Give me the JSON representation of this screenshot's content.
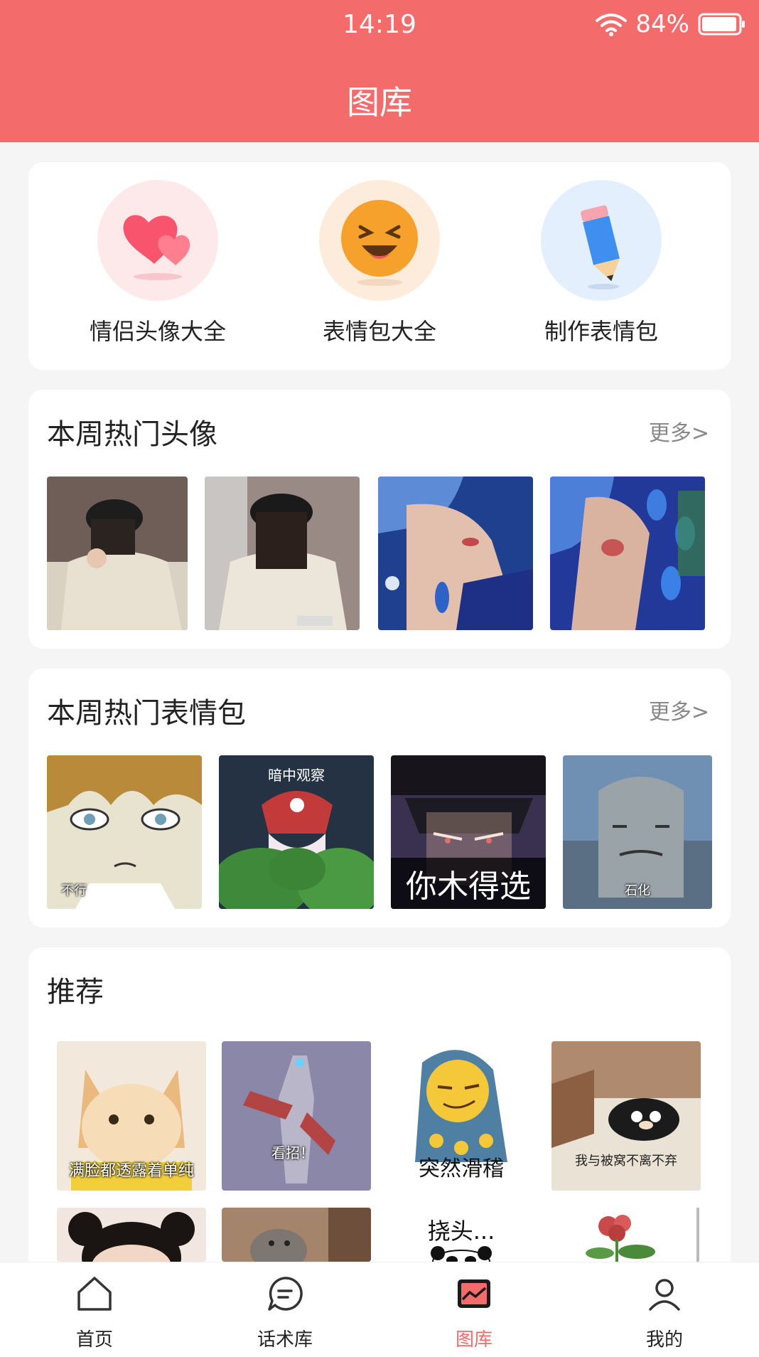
{
  "status_bar": {
    "time": "14:19",
    "battery": "84%"
  },
  "header": {
    "title": "图库"
  },
  "categories": [
    {
      "label": "情侣头像大全",
      "icon": "hearts-icon"
    },
    {
      "label": "表情包大全",
      "icon": "laughing-emoji-icon"
    },
    {
      "label": "制作表情包",
      "icon": "pencil-icon"
    }
  ],
  "hot_avatars": {
    "title": "本周热门头像",
    "more": "更多>"
  },
  "hot_stickers": {
    "title": "本周热门表情包",
    "more": "更多>",
    "captions": [
      "不行",
      "暗中观察",
      "你木得选",
      "石化"
    ]
  },
  "recommend": {
    "title": "推荐",
    "captions": [
      "满脸都透露着单纯",
      "看招！",
      "突然滑稽",
      "我与被窝不离不弃",
      "挠头..."
    ]
  },
  "tabbar": [
    {
      "label": "首页",
      "icon": "home-icon"
    },
    {
      "label": "话术库",
      "icon": "chat-bubble-icon"
    },
    {
      "label": "图库",
      "icon": "gallery-icon"
    },
    {
      "label": "我的",
      "icon": "profile-icon"
    }
  ],
  "colors": {
    "accent": "#f46b6b",
    "background": "#f5f5f5"
  }
}
